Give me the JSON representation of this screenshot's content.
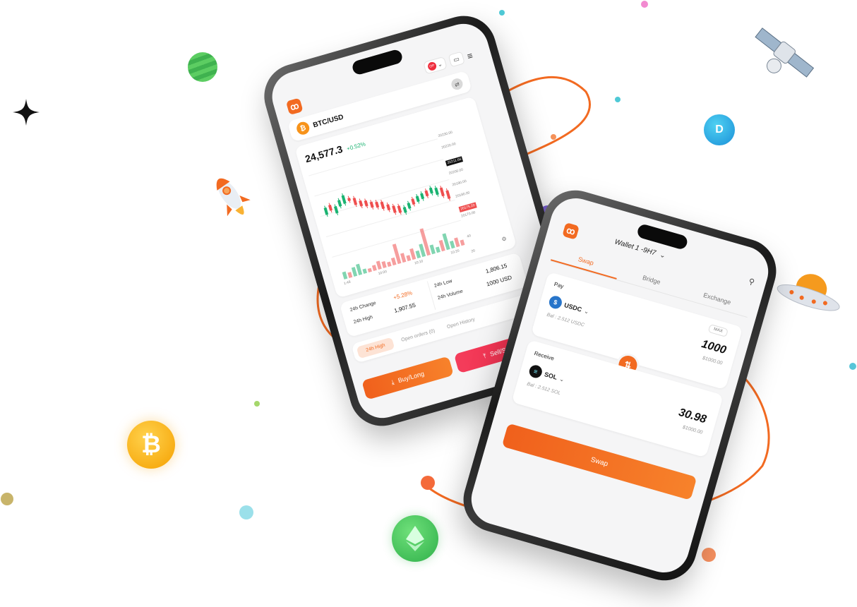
{
  "brand": {
    "accent": "#f26a21",
    "up": "#1ab371",
    "down": "#ef4e4e"
  },
  "left_phone": {
    "pair": "BTC/USD",
    "price": "24,577.3",
    "change": "+0.52%",
    "axis_prices": [
      "20230.00",
      "20220.00",
      "20211.66",
      "20200.00",
      "20190.00",
      "20180.00",
      "20175.20",
      "20170.00"
    ],
    "vol_labels": [
      "40",
      "20"
    ],
    "time_labels": [
      "1:48",
      "10:00",
      "10:10",
      "10:20"
    ],
    "stats": {
      "change_label": "24h Change",
      "change_value": "+5.28%",
      "low_label": "24h Low",
      "low_value": "1,806.15",
      "high_label": "24h High",
      "high_value": "1,907.55",
      "volume_label": "24h Volume",
      "volume_value": "1000 USD"
    },
    "tabs": [
      "24h High",
      "Open orders (0)",
      "Open History"
    ],
    "buy_label": "Buy/Long",
    "sell_label": "Sell/Short",
    "header_badge": "OP"
  },
  "right_phone": {
    "wallet_label": "Wallet 1 -9H7",
    "tabs": [
      "Swap",
      "Bridge",
      "Exchange"
    ],
    "pay": {
      "label": "Pay",
      "max_label": "MAX",
      "token": "USDC",
      "amount": "1000",
      "balance": "Bal : 2.512 USDC",
      "usd_value": "$1000.00"
    },
    "receive": {
      "label": "Receive",
      "token": "SOL",
      "amount": "30.98",
      "balance": "Bal : 2.512 SOL",
      "usd_value": "$1000.00"
    },
    "swap_button": "Swap"
  },
  "decor_icons": [
    "sparkle-icon",
    "green-planet-icon",
    "rocket-icon",
    "bitcoin-coin-icon",
    "ethereum-coin-icon",
    "dash-coin-icon",
    "satellite-icon",
    "ufo-icon",
    "purple-planet-icon"
  ]
}
